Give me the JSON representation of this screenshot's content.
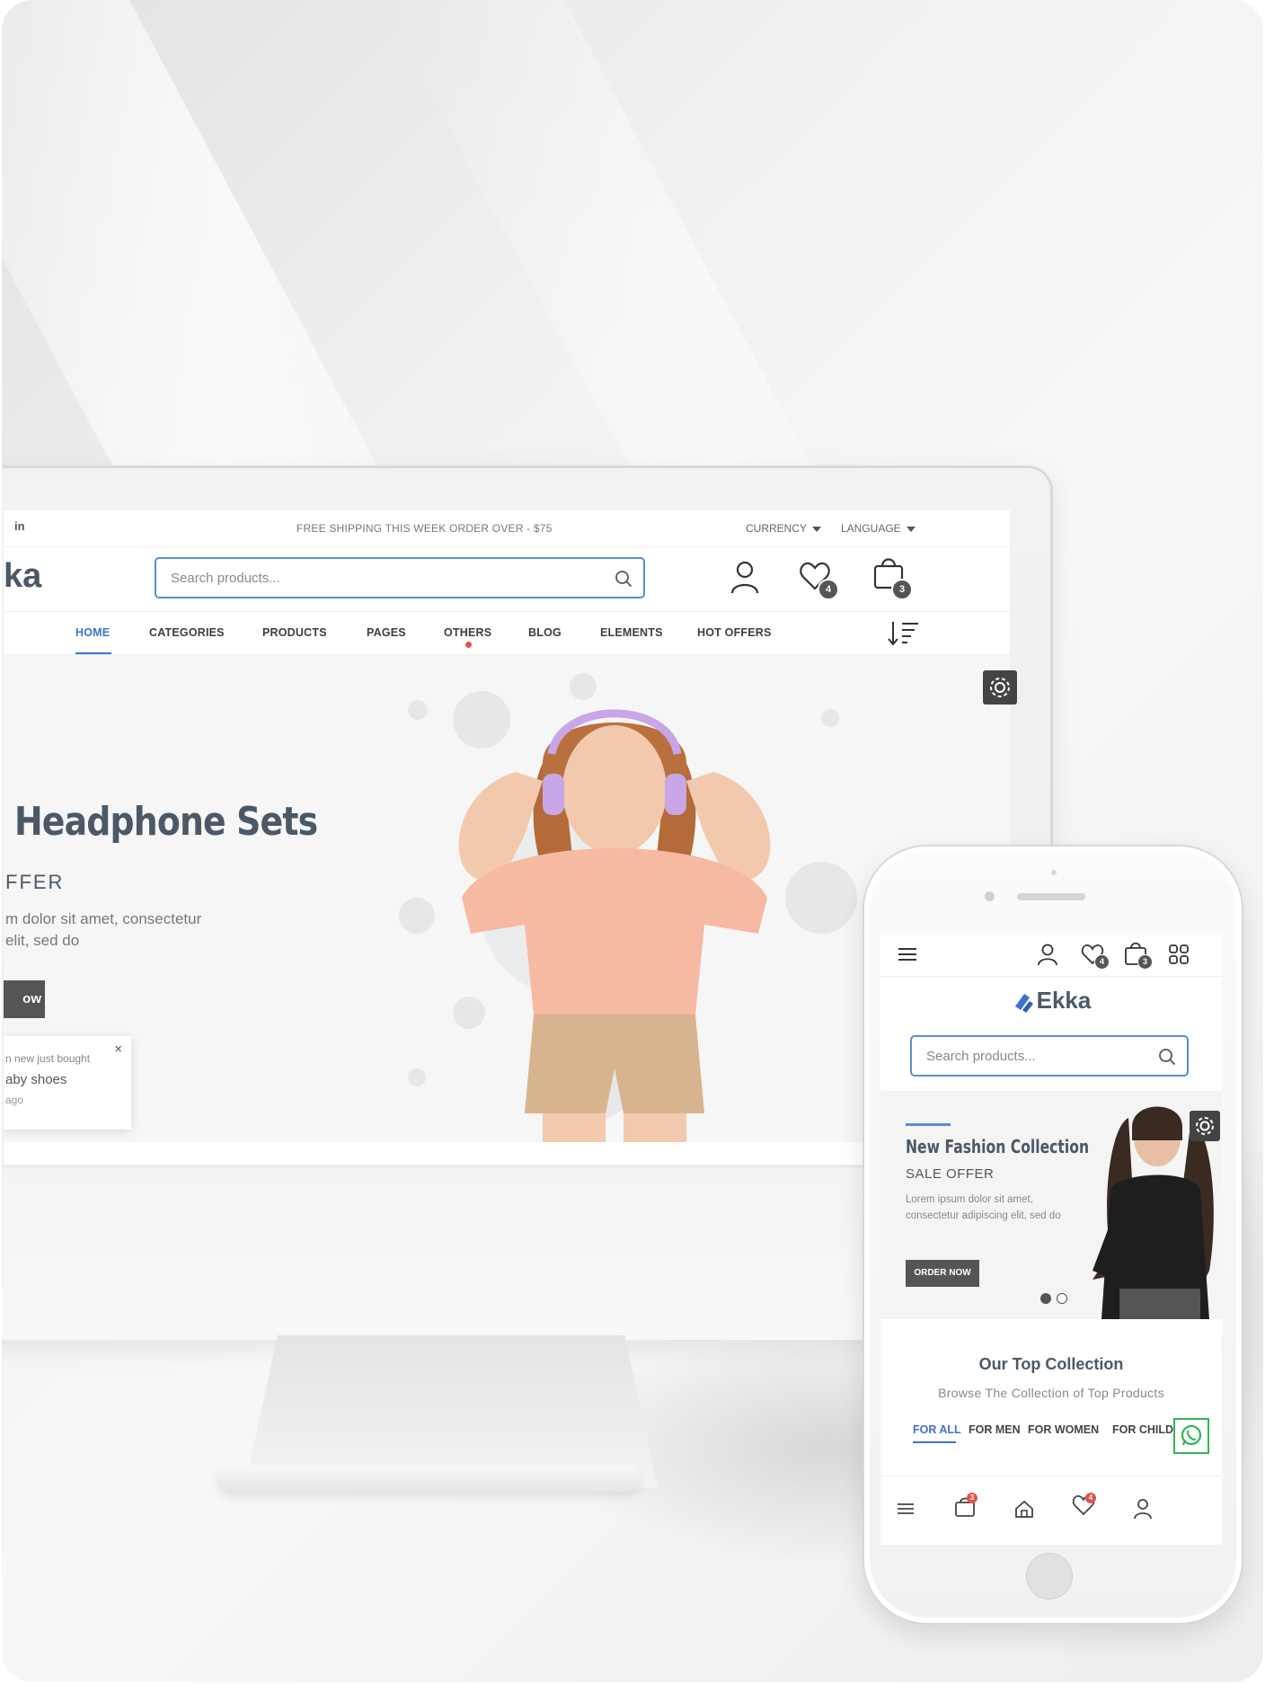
{
  "desktop": {
    "topbar": {
      "social": "in",
      "promo": "FREE SHIPPING THIS WEEK ORDER OVER - $75",
      "currency": "CURRENCY",
      "language": "LANGUAGE"
    },
    "header": {
      "logo_fragment": "ka",
      "search_placeholder": "Search products...",
      "wishlist_count": "4",
      "cart_count": "3"
    },
    "nav": {
      "items": [
        "HOME",
        "CATEGORIES",
        "PRODUCTS",
        "PAGES",
        "OTHERS",
        "BLOG",
        "ELEMENTS",
        "HOT OFFERS"
      ],
      "active": "HOME"
    },
    "hero": {
      "title": "Headphone Sets",
      "offer": "FFER",
      "desc_line1": "m dolor sit amet, consectetur",
      "desc_line2": "elit, sed do",
      "button": "ow"
    },
    "toast": {
      "line1": "n new just bought",
      "line2": "aby shoes",
      "line3": "ago",
      "close": "×"
    }
  },
  "mobile": {
    "header": {
      "wishlist_count": "4",
      "cart_count": "3"
    },
    "logo": "Ekka",
    "search_placeholder": "Search products...",
    "hero": {
      "title": "New Fashion Collection",
      "subtitle": "SALE OFFER",
      "desc": "Lorem ipsum dolor sit amet, consectetur adipiscing elit, sed do",
      "button": "ORDER NOW"
    },
    "collection": {
      "title": "Our Top Collection",
      "subtitle": "Browse The Collection of Top Products",
      "tabs": [
        "FOR ALL",
        "FOR MEN",
        "FOR WOMEN",
        "FOR CHILDR"
      ],
      "active_tab": "FOR ALL"
    },
    "bottom_nav": {
      "cart_count": "3",
      "wishlist_count": "4"
    }
  },
  "colors": {
    "accent": "#3b74c8",
    "text_dark": "#4b5966",
    "button_dark": "#555555",
    "alert_red": "#e6504a",
    "whatsapp_green": "#30b855"
  }
}
